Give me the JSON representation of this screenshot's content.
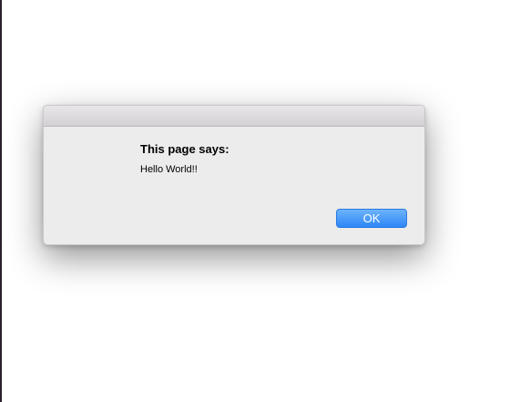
{
  "dialog": {
    "title": "This page says:",
    "message": "Hello World!!",
    "ok_label": "OK"
  },
  "colors": {
    "button_accent": "#3a8ef8",
    "dialog_background": "#ececec"
  }
}
